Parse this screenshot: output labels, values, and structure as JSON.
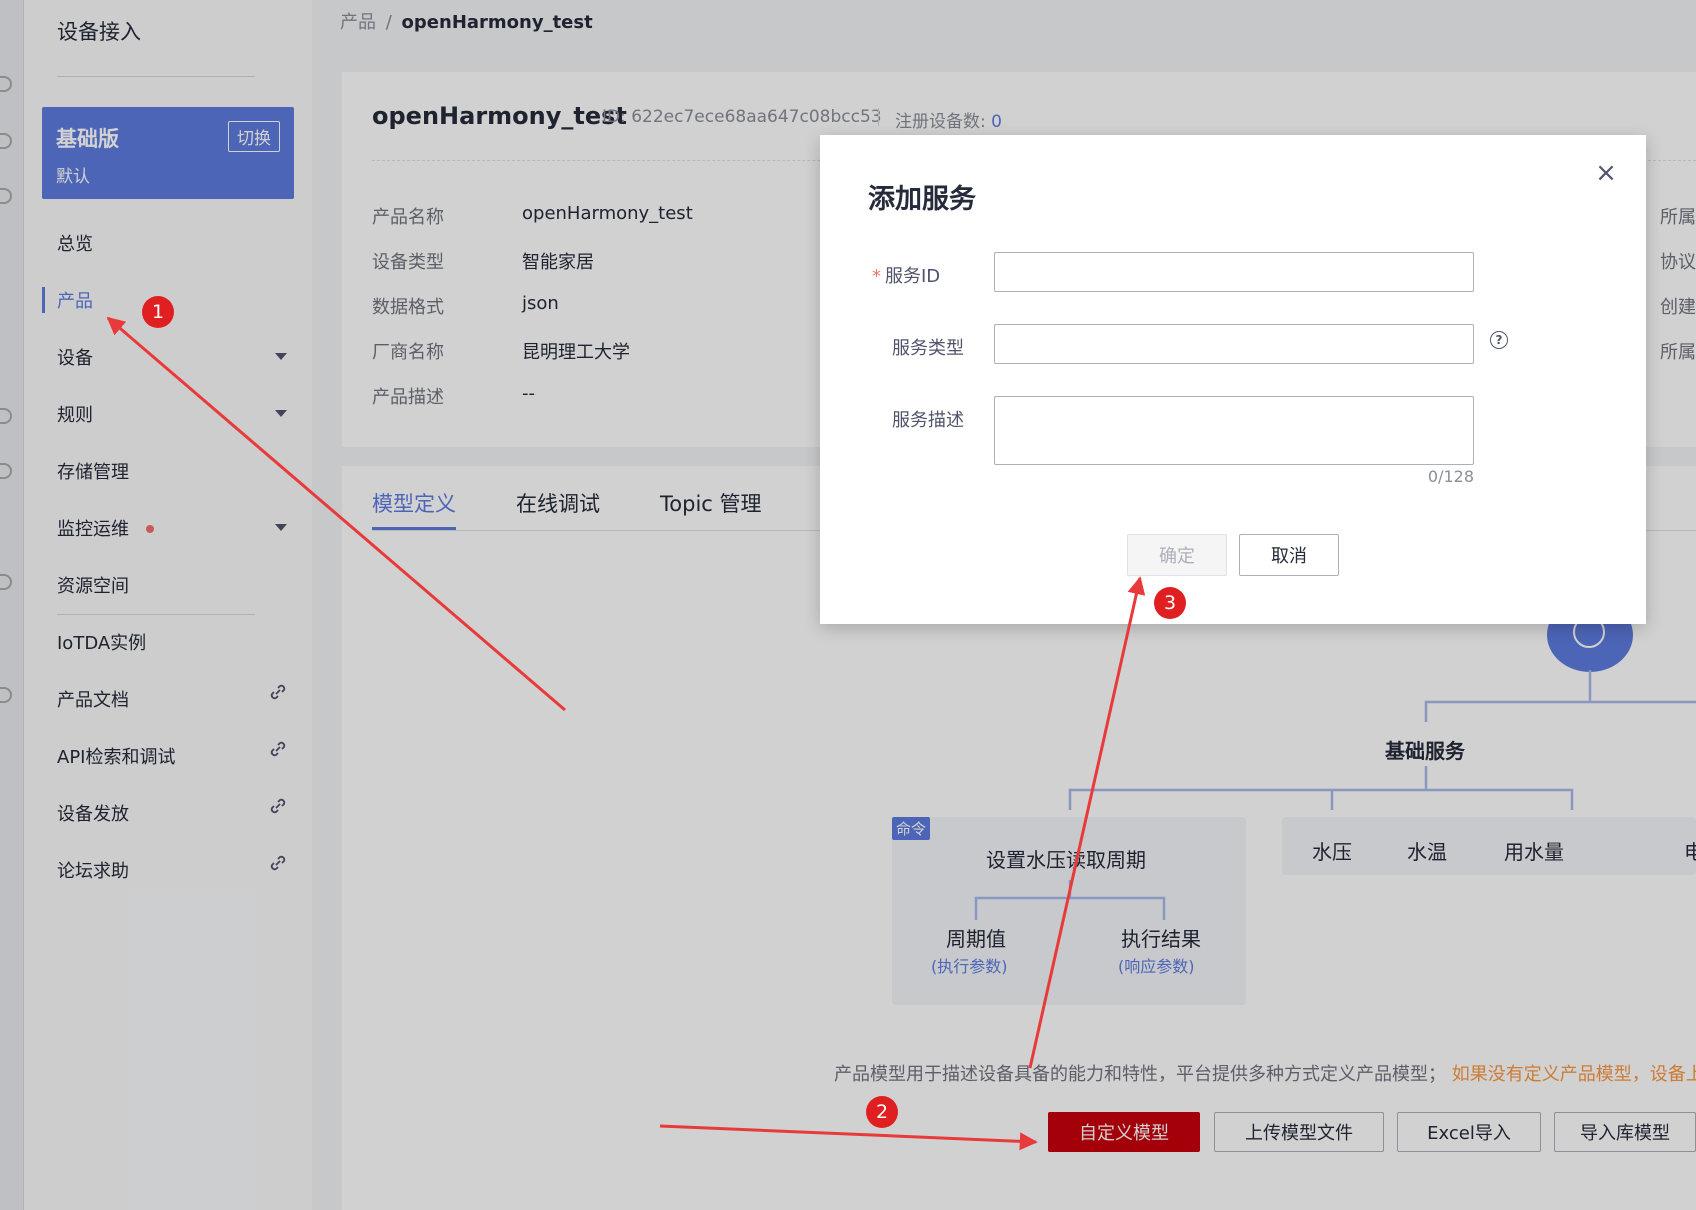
{
  "sidebar": {
    "title": "设备接入",
    "plan": {
      "name": "基础版",
      "switch": "切换",
      "default": "默认"
    },
    "items": [
      {
        "label": "总览"
      },
      {
        "label": "产品"
      },
      {
        "label": "设备"
      },
      {
        "label": "规则"
      },
      {
        "label": "存储管理"
      },
      {
        "label": "监控运维"
      },
      {
        "label": "资源空间"
      },
      {
        "label": "IoTDA实例"
      },
      {
        "label": "产品文档"
      },
      {
        "label": "API检索和调试"
      },
      {
        "label": "设备发放"
      },
      {
        "label": "论坛求助"
      }
    ]
  },
  "breadcrumb": {
    "root": "产品",
    "sep": "/",
    "current": "openHarmony_test"
  },
  "product": {
    "name": "openHarmony_test",
    "id_text": "ID: 622ec7ece68aa647c08bcc53",
    "count_label": "注册设备数: ",
    "count_value": "0",
    "fields": [
      {
        "label": "产品名称",
        "value": "openHarmony_test"
      },
      {
        "label": "设备类型",
        "value": "智能家居"
      },
      {
        "label": "数据格式",
        "value": "json"
      },
      {
        "label": "厂商名称",
        "value": "昆明理工大学"
      },
      {
        "label": "产品描述",
        "value": "--"
      }
    ],
    "right_labels": [
      "所属",
      "协议",
      "创建",
      "所属"
    ]
  },
  "tabs": [
    {
      "label": "模型定义"
    },
    {
      "label": "在线调试"
    },
    {
      "label": "Topic 管理"
    }
  ],
  "diagram": {
    "basic_service": "基础服务",
    "command_badge": "命令",
    "command_name": "设置水压读取周期",
    "param_name": "周期值",
    "param_type": "(执行参数)",
    "result_name": "执行结果",
    "result_type": "(响应参数)",
    "properties": [
      "水压",
      "水温",
      "用水量",
      "电"
    ]
  },
  "description": {
    "text": "产品模型用于描述设备具备的能力和特性，平台提供多种方式定义产品模型；",
    "warn": "如果没有定义产品模型，设备上"
  },
  "actions": {
    "custom_model": "自定义模型",
    "upload_model": "上传模型文件",
    "excel_import": "Excel导入",
    "import_library": "导入库模型"
  },
  "modal": {
    "title": "添加服务",
    "close": "×",
    "service_id_label": "服务ID",
    "required_mark": "*",
    "service_type_label": "服务类型",
    "service_desc_label": "服务描述",
    "service_id_value": "",
    "service_type_value": "",
    "service_desc_value": "",
    "help": "?",
    "counter": "0/128",
    "confirm": "确定",
    "cancel": "取消"
  },
  "annotations": [
    "1",
    "2",
    "3"
  ],
  "colors": {
    "accent": "#5e7ce0",
    "primary_button": "#c7000b",
    "annotation": "#e02020"
  }
}
